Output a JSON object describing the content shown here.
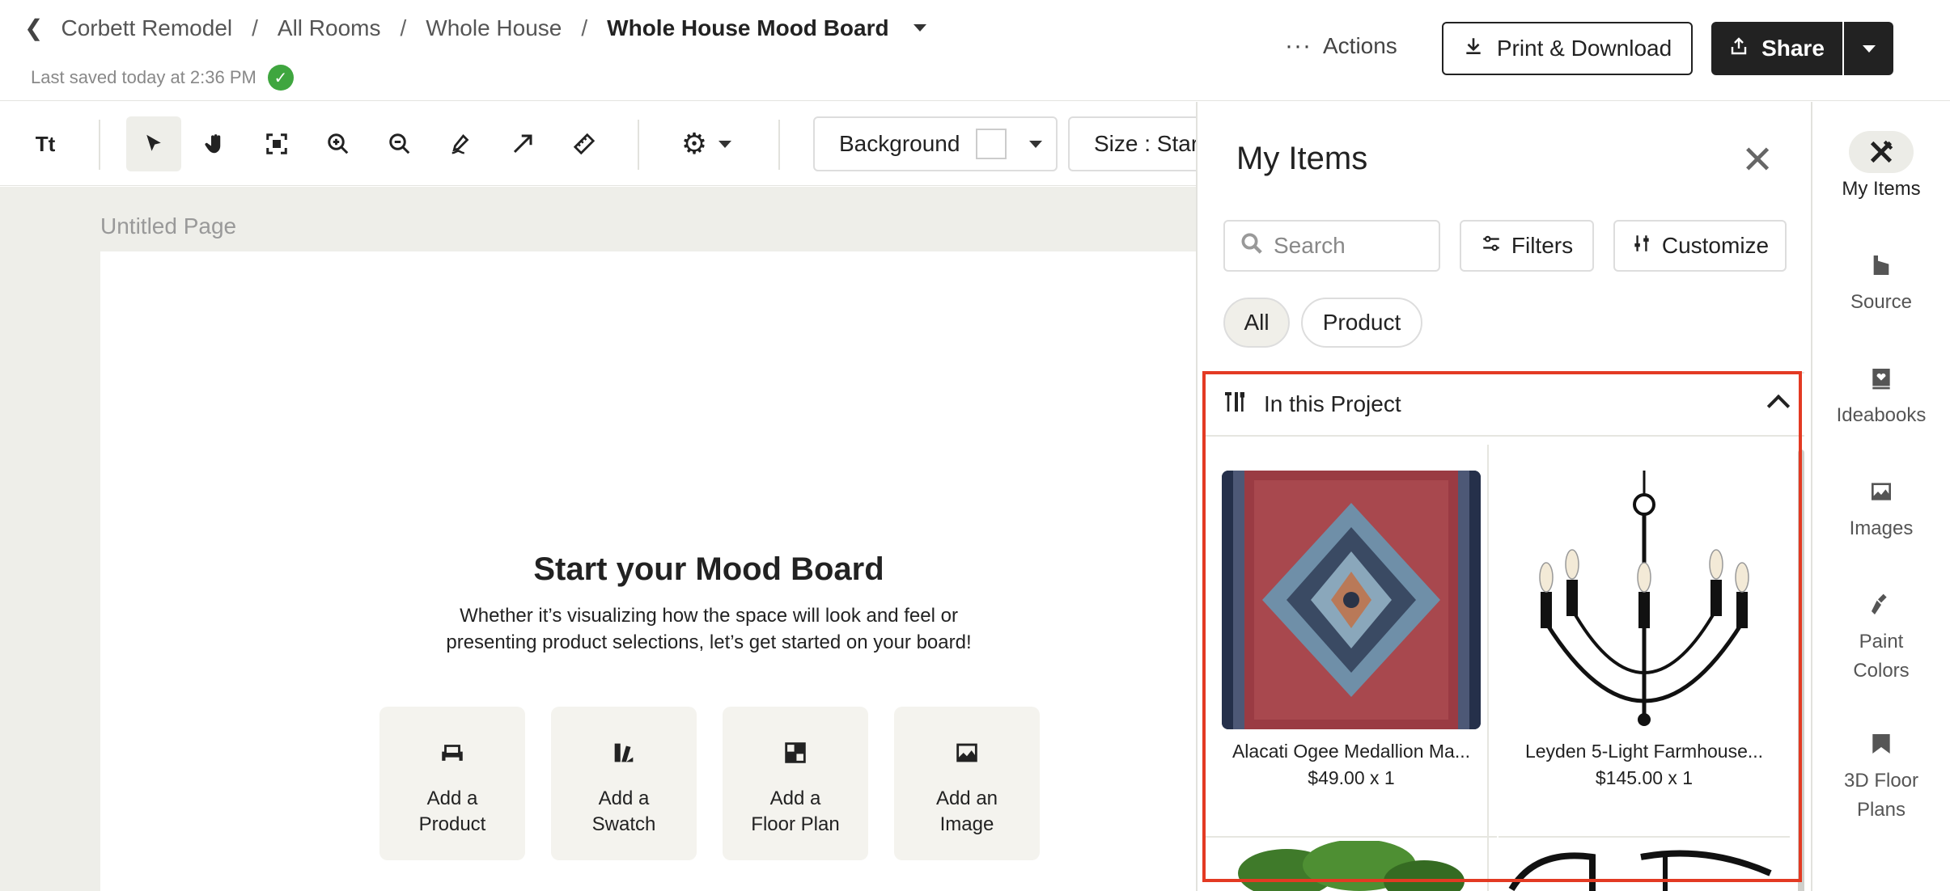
{
  "header": {
    "back_icon": "chevron-left-icon",
    "breadcrumbs": [
      "Corbett Remodel",
      "All Rooms",
      "Whole House"
    ],
    "separator": "/",
    "current": "Whole House Mood Board",
    "saved_text": "Last saved today at 2:36 PM",
    "actions_label": "Actions",
    "print_label": "Print & Download",
    "share_label": "Share"
  },
  "toolbar": {
    "text_tool": "Tt",
    "background_label": "Background",
    "size_label": "Size : Star"
  },
  "canvas": {
    "page_label": "Untitled Page",
    "start_title": "Start your Mood Board",
    "start_desc_line1": "Whether it’s visualizing how the space will look and feel or",
    "start_desc_line2": "presenting product selections, let’s get started on your board!",
    "cards": [
      {
        "line1": "Add a",
        "line2": "Product",
        "icon": "armchair-icon"
      },
      {
        "line1": "Add a",
        "line2": "Swatch",
        "icon": "swatch-icon"
      },
      {
        "line1": "Add a",
        "line2": "Floor Plan",
        "icon": "floor-plan-icon"
      },
      {
        "line1": "Add an",
        "line2": "Image",
        "icon": "image-icon"
      }
    ]
  },
  "panel": {
    "title": "My Items",
    "search_placeholder": "Search",
    "filters_label": "Filters",
    "customize_label": "Customize",
    "chips": [
      "All",
      "Product"
    ],
    "section_title": "In this Project",
    "items": [
      {
        "name": "Alacati Ogee Medallion Ma...",
        "price": "$49.00 x 1"
      },
      {
        "name": "Leyden 5-Light Farmhouse...",
        "price": "$145.00 x 1"
      }
    ]
  },
  "rail": {
    "items": [
      {
        "label1": "My Items",
        "label2": "",
        "icon": "pencil-ruler-icon"
      },
      {
        "label1": "Source",
        "label2": "",
        "icon": "source-icon"
      },
      {
        "label1": "Ideabooks",
        "label2": "",
        "icon": "ideabook-icon"
      },
      {
        "label1": "Images",
        "label2": "",
        "icon": "image-icon"
      },
      {
        "label1": "Paint",
        "label2": "Colors",
        "icon": "paintbrush-icon"
      },
      {
        "label1": "3D Floor",
        "label2": "Plans",
        "icon": "floor-plan-3d-icon"
      }
    ]
  },
  "colors": {
    "highlight": "#e33a23",
    "saved_check": "#3fa63f",
    "dark_button": "#222222",
    "canvas_bg": "#eeeee9"
  }
}
